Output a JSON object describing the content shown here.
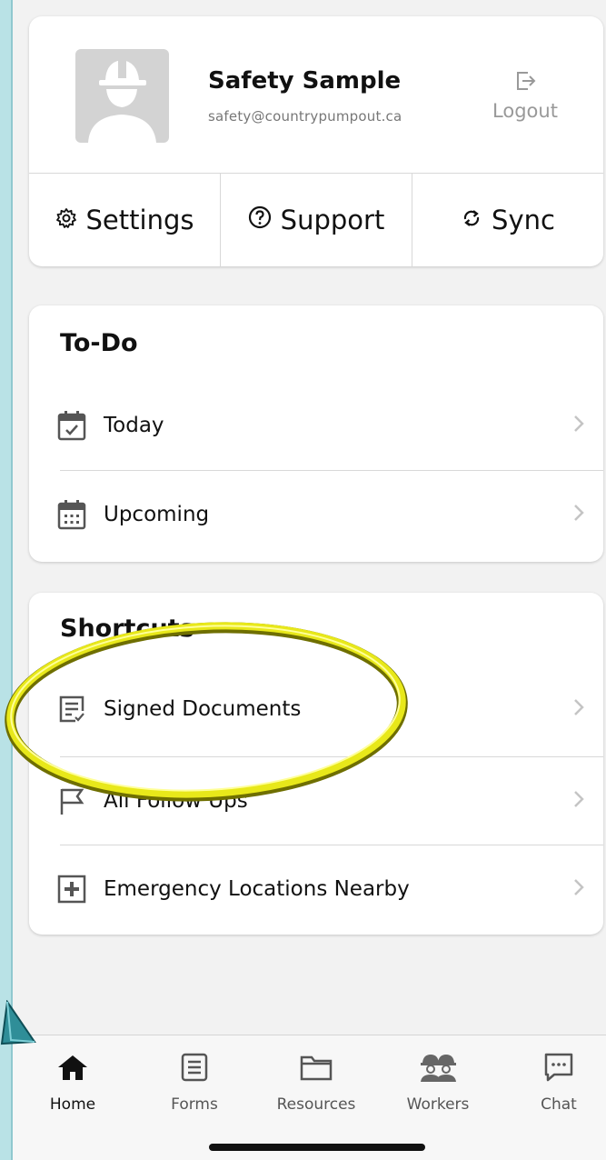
{
  "profile": {
    "name": "Safety  Sample",
    "email": "safety@countrypumpout.ca",
    "logout_label": "Logout",
    "actions": [
      {
        "label": "Settings",
        "icon": "gear-icon"
      },
      {
        "label": "Support",
        "icon": "question-circle-icon"
      },
      {
        "label": "Sync",
        "icon": "sync-icon"
      }
    ]
  },
  "todo": {
    "title": "To-Do",
    "items": [
      {
        "label": "Today",
        "icon": "calendar-check-icon"
      },
      {
        "label": "Upcoming",
        "icon": "calendar-grid-icon"
      }
    ]
  },
  "shortcuts": {
    "title": "Shortcuts",
    "items": [
      {
        "label": "Signed Documents",
        "icon": "signed-document-icon"
      },
      {
        "label": "All Follow Ups",
        "icon": "flag-icon"
      },
      {
        "label": "Emergency Locations Nearby",
        "icon": "first-aid-icon"
      }
    ]
  },
  "tabbar": {
    "tabs": [
      {
        "label": "Home",
        "icon": "home-icon",
        "active": true
      },
      {
        "label": "Forms",
        "icon": "form-icon"
      },
      {
        "label": "Resources",
        "icon": "folder-icon"
      },
      {
        "label": "Workers",
        "icon": "workers-icon"
      },
      {
        "label": "Chat",
        "icon": "chat-icon"
      }
    ]
  },
  "colors": {
    "background": "#f2f2f2",
    "card": "#ffffff",
    "highlight": "#e8e81a",
    "frame": "#b9e2e6"
  }
}
